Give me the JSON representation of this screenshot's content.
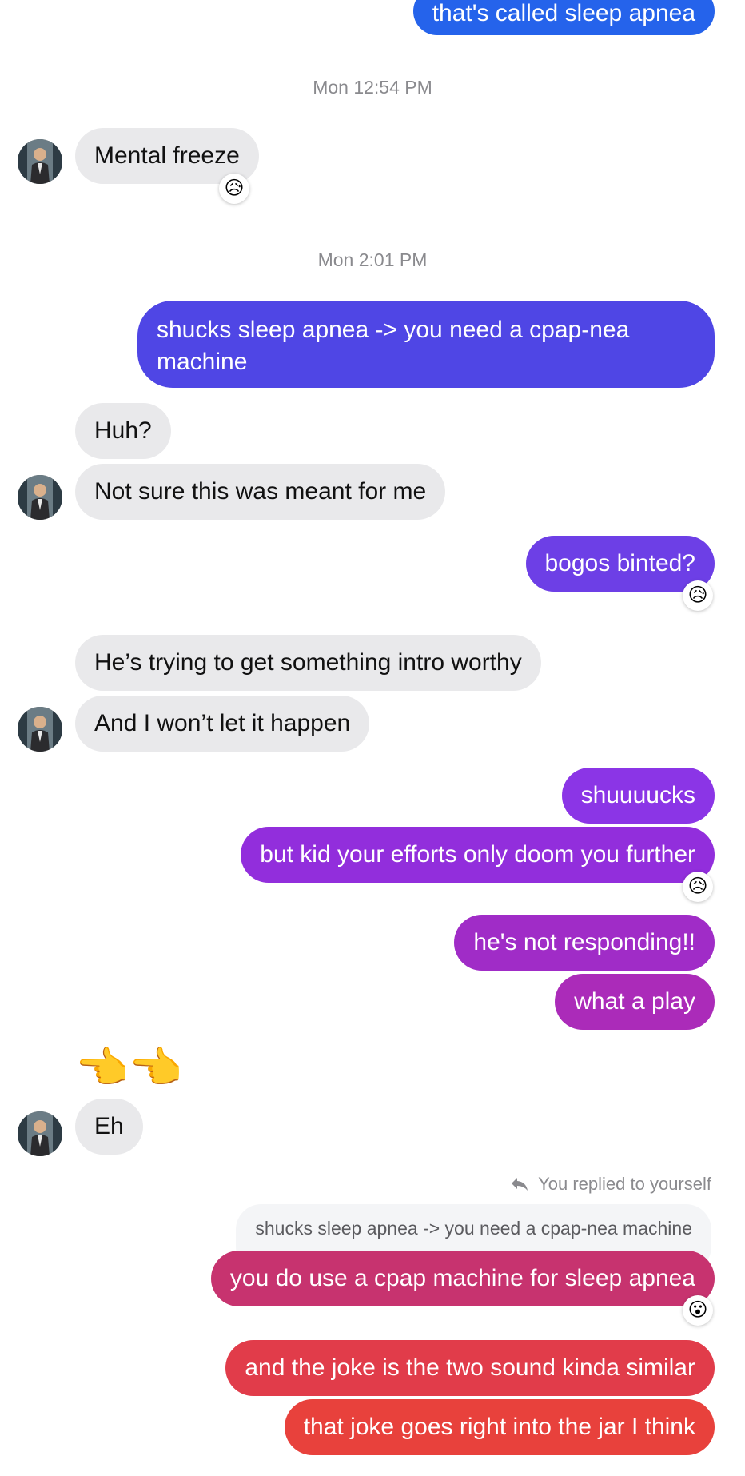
{
  "messages": {
    "m01": {
      "text": "that's called sleep apnea"
    },
    "t1": {
      "text": "Mon 12:54 PM"
    },
    "m02": {
      "text": "Mental freeze",
      "reaction": "😥"
    },
    "t2": {
      "text": "Mon 2:01 PM"
    },
    "m03": {
      "text": "shucks sleep apnea -> you need a cpap-nea machine"
    },
    "m04": {
      "text": "Huh?"
    },
    "m05": {
      "text": "Not sure this was meant for me"
    },
    "m06": {
      "text": "bogos binted?",
      "reaction": "😥"
    },
    "m07": {
      "text": "He’s trying to get something intro worthy"
    },
    "m08": {
      "text": "And I won’t let it happen"
    },
    "m09": {
      "text": "shuuuucks"
    },
    "m10": {
      "text": "but kid your efforts only doom you further",
      "reaction": "😥"
    },
    "m11": {
      "text": "he's not responding!!"
    },
    "m12": {
      "text": "what a play"
    },
    "m13": {
      "text": "👈👈"
    },
    "m14": {
      "text": "Eh"
    },
    "reply": {
      "note": "You replied to yourself",
      "quoted": "shucks sleep apnea -> you need a cpap-nea machine"
    },
    "m15": {
      "text": "you do use a cpap machine for sleep apnea",
      "reaction": "😮"
    },
    "m16": {
      "text": "and the joke is the two sound kinda similar"
    },
    "m17": {
      "text": "that joke goes right into the jar I think"
    }
  },
  "colors": {
    "incoming": "#e9e9eb",
    "gradient": [
      "#2563eb",
      "#4f46e5",
      "#7c3aed",
      "#9333ea",
      "#a21caf",
      "#c026d3",
      "#db2777",
      "#e11d48",
      "#ef4444"
    ]
  }
}
